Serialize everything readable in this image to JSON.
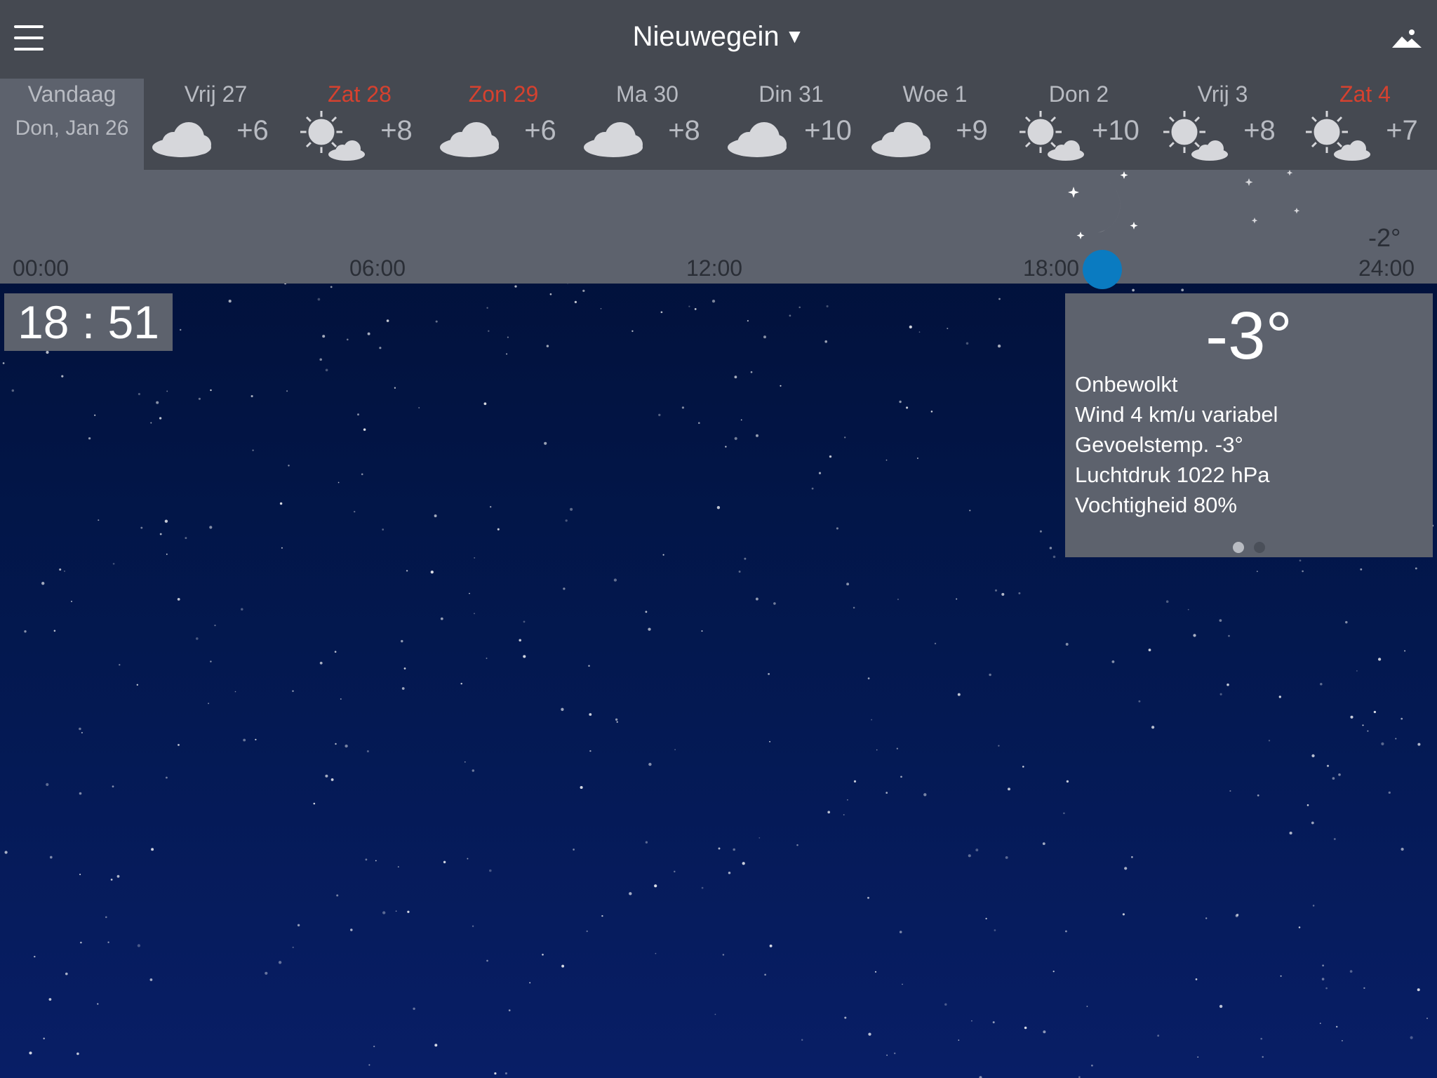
{
  "header": {
    "city": "Nieuwegein",
    "caret": "▼",
    "menu_icon": "hamburger-menu-icon",
    "background_icon": "mountain-icon"
  },
  "days": [
    {
      "name": "Vandaag",
      "date": "Don, Jan 26",
      "today": true
    },
    {
      "name": "Vrij 27",
      "icon": "cloud-icon",
      "temp": "+6"
    },
    {
      "name": "Zat 28",
      "icon": "sun-cloud-icon",
      "temp": "+8",
      "weekend": true
    },
    {
      "name": "Zon 29",
      "icon": "cloud-icon",
      "temp": "+6",
      "weekend": true
    },
    {
      "name": "Ma 30",
      "icon": "cloud-icon",
      "temp": "+8"
    },
    {
      "name": "Din 31",
      "icon": "cloud-icon",
      "temp": "+10"
    },
    {
      "name": "Woe 1",
      "icon": "cloud-icon",
      "temp": "+9"
    },
    {
      "name": "Don 2",
      "icon": "sun-cloud-icon",
      "temp": "+10"
    },
    {
      "name": "Vrij 3",
      "icon": "sun-cloud-icon",
      "temp": "+8"
    },
    {
      "name": "Zat 4",
      "icon": "sun-cloud-icon",
      "temp": "+7",
      "weekend": true
    }
  ],
  "timeline": {
    "labels": [
      "00:00",
      "06:00",
      "12:00",
      "18:00",
      "24:00"
    ],
    "temp": "-2°"
  },
  "clock": "18 : 51",
  "detail": {
    "temp": "-3°",
    "condition": "Onbewolkt",
    "wind": "Wind  4 km/u variabel",
    "feels_like": "Gevoelstemp. -3°",
    "pressure": "Luchtdruk 1022 hPa",
    "humidity": "Vochtigheid  80%",
    "page_count": 2,
    "active_page": 1
  },
  "colors": {
    "bar": "#454951",
    "panel": "#5d626d",
    "weekend": "#d5412f",
    "accent": "#0a7bc1",
    "sky_top": "#000d2e",
    "sky_bottom": "#081e66"
  }
}
